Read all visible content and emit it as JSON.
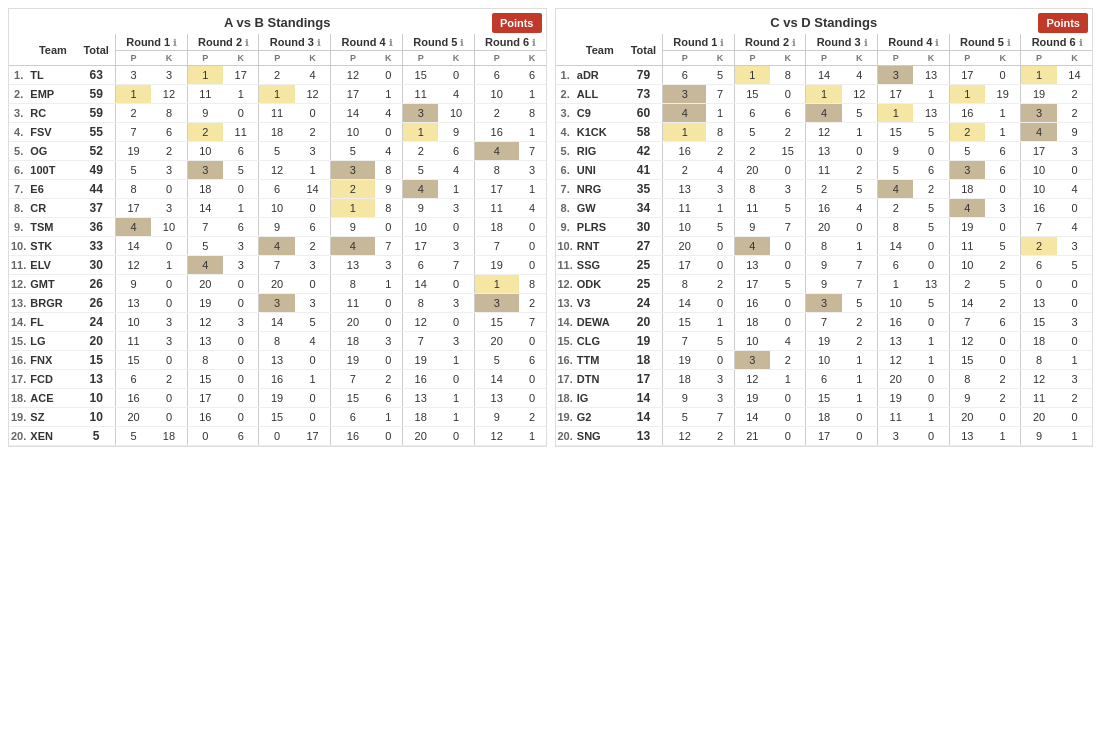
{
  "leftTable": {
    "title": "A vs B Standings",
    "pointsBtn": "Points",
    "columns": [
      "Team",
      "Total",
      "Round 1",
      "Round 2",
      "Round 3",
      "Round 4",
      "Round 5",
      "Round 6"
    ],
    "rows": [
      {
        "rank": "1.",
        "logo": "TL",
        "abbr": "TL",
        "total": "63",
        "r1p": "3",
        "r1k": "3",
        "r2p": "1",
        "r2k": "17",
        "r3p": "2",
        "r3k": "4",
        "r4p": "12",
        "r4k": "0",
        "r5p": "15",
        "r5k": "0",
        "r6p": "6",
        "r6k": "6",
        "highlights": {
          "r2p": "gold"
        }
      },
      {
        "rank": "2.",
        "logo": "EMP",
        "abbr": "EMP",
        "total": "59",
        "r1p": "1",
        "r1k": "12",
        "r2p": "11",
        "r2k": "1",
        "r3p": "1",
        "r3k": "12",
        "r4p": "17",
        "r4k": "1",
        "r5p": "11",
        "r5k": "4",
        "r6p": "10",
        "r6k": "1",
        "highlights": {
          "r1p": "gold",
          "r3p": "gold"
        }
      },
      {
        "rank": "3.",
        "logo": "RC",
        "abbr": "RC",
        "total": "59",
        "r1p": "2",
        "r1k": "8",
        "r2p": "9",
        "r2k": "0",
        "r3p": "11",
        "r3k": "0",
        "r4p": "14",
        "r4k": "4",
        "r5p": "3",
        "r5k": "10",
        "r6p": "2",
        "r6k": "8",
        "highlights": {
          "r5p": "tan"
        }
      },
      {
        "rank": "4.",
        "logo": "FSV",
        "abbr": "FSV",
        "total": "55",
        "r1p": "7",
        "r1k": "6",
        "r2p": "2",
        "r2k": "11",
        "r3p": "18",
        "r3k": "2",
        "r4p": "10",
        "r4k": "0",
        "r5p": "1",
        "r5k": "9",
        "r6p": "16",
        "r6k": "1",
        "highlights": {
          "r2p": "gold",
          "r5p": "gold"
        }
      },
      {
        "rank": "5.",
        "logo": "OG",
        "abbr": "OG",
        "total": "52",
        "r1p": "19",
        "r1k": "2",
        "r2p": "10",
        "r2k": "6",
        "r3p": "5",
        "r3k": "3",
        "r4p": "5",
        "r4k": "4",
        "r5p": "2",
        "r5k": "6",
        "r6p": "4",
        "r6k": "7",
        "highlights": {
          "r6p": "tan"
        }
      },
      {
        "rank": "6.",
        "logo": "100T",
        "abbr": "100T",
        "total": "49",
        "r1p": "5",
        "r1k": "3",
        "r2p": "3",
        "r2k": "5",
        "r3p": "12",
        "r3k": "1",
        "r4p": "3",
        "r4k": "8",
        "r5p": "5",
        "r5k": "4",
        "r6p": "8",
        "r6k": "3",
        "highlights": {
          "r2p": "tan",
          "r4p": "tan"
        }
      },
      {
        "rank": "7.",
        "logo": "E6",
        "abbr": "E6",
        "total": "44",
        "r1p": "8",
        "r1k": "0",
        "r2p": "18",
        "r2k": "0",
        "r3p": "6",
        "r3k": "14",
        "r4p": "2",
        "r4k": "9",
        "r5p": "4",
        "r5k": "1",
        "r6p": "17",
        "r6k": "1",
        "highlights": {
          "r4p": "gold",
          "r5p": "tan"
        }
      },
      {
        "rank": "8.",
        "logo": "CR",
        "abbr": "CR",
        "total": "37",
        "r1p": "17",
        "r1k": "3",
        "r2p": "14",
        "r2k": "1",
        "r3p": "10",
        "r3k": "0",
        "r4p": "1",
        "r4k": "8",
        "r5p": "9",
        "r5k": "3",
        "r6p": "11",
        "r6k": "4",
        "highlights": {
          "r4p": "gold"
        }
      },
      {
        "rank": "9.",
        "logo": "TSM",
        "abbr": "TSM",
        "total": "36",
        "r1p": "4",
        "r1k": "10",
        "r2p": "7",
        "r2k": "6",
        "r3p": "9",
        "r3k": "6",
        "r4p": "9",
        "r4k": "0",
        "r5p": "10",
        "r5k": "0",
        "r6p": "18",
        "r6k": "0",
        "highlights": {
          "r1p": "tan"
        }
      },
      {
        "rank": "10.",
        "logo": "STK",
        "abbr": "STK",
        "total": "33",
        "r1p": "14",
        "r1k": "0",
        "r2p": "5",
        "r2k": "3",
        "r3p": "4",
        "r3k": "2",
        "r4p": "4",
        "r4k": "7",
        "r5p": "17",
        "r5k": "3",
        "r6p": "7",
        "r6k": "0",
        "highlights": {
          "r3p": "tan",
          "r4p": "tan"
        }
      },
      {
        "rank": "11.",
        "logo": "ELV",
        "abbr": "ELV",
        "total": "30",
        "r1p": "12",
        "r1k": "1",
        "r2p": "4",
        "r2k": "3",
        "r3p": "7",
        "r3k": "3",
        "r4p": "13",
        "r4k": "3",
        "r5p": "6",
        "r5k": "7",
        "r6p": "19",
        "r6k": "0",
        "highlights": {
          "r2p": "tan"
        }
      },
      {
        "rank": "12.",
        "logo": "GMT",
        "abbr": "GMT",
        "total": "26",
        "r1p": "9",
        "r1k": "0",
        "r2p": "20",
        "r2k": "0",
        "r3p": "20",
        "r3k": "0",
        "r4p": "8",
        "r4k": "1",
        "r5p": "14",
        "r5k": "0",
        "r6p": "1",
        "r6k": "8",
        "highlights": {
          "r6p": "gold"
        }
      },
      {
        "rank": "13.",
        "logo": "BRGR",
        "abbr": "BRGR",
        "total": "26",
        "r1p": "13",
        "r1k": "0",
        "r2p": "19",
        "r2k": "0",
        "r3p": "3",
        "r3k": "3",
        "r4p": "11",
        "r4k": "0",
        "r5p": "8",
        "r5k": "3",
        "r6p": "3",
        "r6k": "2",
        "highlights": {
          "r3p": "tan",
          "r6p": "tan"
        }
      },
      {
        "rank": "14.",
        "logo": "FL",
        "abbr": "FL",
        "total": "24",
        "r1p": "10",
        "r1k": "3",
        "r2p": "12",
        "r2k": "3",
        "r3p": "14",
        "r3k": "5",
        "r4p": "20",
        "r4k": "0",
        "r5p": "12",
        "r5k": "0",
        "r6p": "15",
        "r6k": "7",
        "highlights": {}
      },
      {
        "rank": "15.",
        "logo": "LG",
        "abbr": "LG",
        "total": "20",
        "r1p": "11",
        "r1k": "3",
        "r2p": "13",
        "r2k": "0",
        "r3p": "8",
        "r3k": "4",
        "r4p": "18",
        "r4k": "3",
        "r5p": "7",
        "r5k": "3",
        "r6p": "20",
        "r6k": "0",
        "highlights": {}
      },
      {
        "rank": "16.",
        "logo": "FNX",
        "abbr": "FNX",
        "total": "15",
        "r1p": "15",
        "r1k": "0",
        "r2p": "8",
        "r2k": "0",
        "r3p": "13",
        "r3k": "0",
        "r4p": "19",
        "r4k": "0",
        "r5p": "19",
        "r5k": "1",
        "r6p": "5",
        "r6k": "6",
        "highlights": {}
      },
      {
        "rank": "17.",
        "logo": "FCD",
        "abbr": "FCD",
        "total": "13",
        "r1p": "6",
        "r1k": "2",
        "r2p": "15",
        "r2k": "0",
        "r3p": "16",
        "r3k": "1",
        "r4p": "7",
        "r4k": "2",
        "r5p": "16",
        "r5k": "0",
        "r6p": "14",
        "r6k": "0",
        "highlights": {}
      },
      {
        "rank": "18.",
        "logo": "ACE",
        "abbr": "ACE",
        "total": "10",
        "r1p": "16",
        "r1k": "0",
        "r2p": "17",
        "r2k": "0",
        "r3p": "19",
        "r3k": "0",
        "r4p": "15",
        "r4k": "6",
        "r5p": "13",
        "r5k": "1",
        "r6p": "13",
        "r6k": "0",
        "highlights": {}
      },
      {
        "rank": "19.",
        "logo": "SZ",
        "abbr": "SZ",
        "total": "10",
        "r1p": "20",
        "r1k": "0",
        "r2p": "16",
        "r2k": "0",
        "r3p": "15",
        "r3k": "0",
        "r4p": "6",
        "r4k": "1",
        "r5p": "18",
        "r5k": "1",
        "r6p": "9",
        "r6k": "2",
        "highlights": {}
      },
      {
        "rank": "20.",
        "logo": "XEN",
        "abbr": "XEN",
        "total": "5",
        "r1p": "5",
        "r1k": "18",
        "r2p": "0",
        "r2k": "6",
        "r3p": "0",
        "r3k": "17",
        "r4p": "16",
        "r4k": "0",
        "r5p": "20",
        "r5k": "0",
        "r6p": "12",
        "r6k": "1",
        "highlights": {}
      }
    ]
  },
  "rightTable": {
    "title": "C vs D Standings",
    "pointsBtn": "Points",
    "columns": [
      "Team",
      "Total",
      "Round 1",
      "Round 2",
      "Round 3",
      "Round 4",
      "Round 5",
      "Round 6"
    ],
    "rows": [
      {
        "rank": "1.",
        "abbr": "aDR",
        "total": "79",
        "r1p": "6",
        "r1k": "5",
        "r2p": "1",
        "r2k": "8",
        "r3p": "14",
        "r3k": "4",
        "r4p": "3",
        "r4k": "13",
        "r5p": "17",
        "r5k": "0",
        "r6p": "1",
        "r6k": "14",
        "highlights": {
          "r2p": "gold",
          "r4p": "tan",
          "r6p": "gold"
        }
      },
      {
        "rank": "2.",
        "abbr": "ALL",
        "total": "73",
        "r1p": "3",
        "r1k": "7",
        "r2p": "15",
        "r2k": "0",
        "r3p": "1",
        "r3k": "12",
        "r4p": "17",
        "r4k": "1",
        "r5p": "1",
        "r5k": "19",
        "r6p": "19",
        "r6k": "2",
        "highlights": {
          "r1p": "tan",
          "r3p": "gold",
          "r5p": "gold"
        }
      },
      {
        "rank": "3.",
        "abbr": "C9",
        "total": "60",
        "r1p": "4",
        "r1k": "1",
        "r2p": "6",
        "r2k": "6",
        "r3p": "4",
        "r3k": "5",
        "r4p": "1",
        "r4k": "13",
        "r5p": "16",
        "r5k": "1",
        "r6p": "3",
        "r6k": "2",
        "highlights": {
          "r1p": "tan",
          "r3p": "tan",
          "r4p": "gold",
          "r6p": "tan"
        }
      },
      {
        "rank": "4.",
        "abbr": "K1CK",
        "total": "58",
        "r1p": "1",
        "r1k": "8",
        "r2p": "5",
        "r2k": "2",
        "r3p": "12",
        "r3k": "1",
        "r4p": "15",
        "r4k": "5",
        "r5p": "2",
        "r5k": "1",
        "r6p": "4",
        "r6k": "9",
        "highlights": {
          "r1p": "gold",
          "r5p": "gold",
          "r6p": "tan"
        }
      },
      {
        "rank": "5.",
        "abbr": "RIG",
        "total": "42",
        "r1p": "16",
        "r1k": "2",
        "r2p": "2",
        "r2k": "15",
        "r3p": "13",
        "r3k": "0",
        "r4p": "9",
        "r4k": "0",
        "r5p": "5",
        "r5k": "6",
        "r6p": "17",
        "r6k": "3",
        "highlights": {}
      },
      {
        "rank": "6.",
        "abbr": "UNI",
        "total": "41",
        "r1p": "2",
        "r1k": "4",
        "r2p": "20",
        "r2k": "0",
        "r3p": "11",
        "r3k": "2",
        "r4p": "5",
        "r4k": "6",
        "r5p": "3",
        "r5k": "6",
        "r6p": "10",
        "r6k": "0",
        "highlights": {
          "r5p": "tan"
        }
      },
      {
        "rank": "7.",
        "abbr": "NRG",
        "total": "35",
        "r1p": "13",
        "r1k": "3",
        "r2p": "8",
        "r2k": "3",
        "r3p": "2",
        "r3k": "5",
        "r4p": "4",
        "r4k": "2",
        "r5p": "18",
        "r5k": "0",
        "r6p": "10",
        "r6k": "4",
        "highlights": {
          "r4p": "tan"
        }
      },
      {
        "rank": "8.",
        "abbr": "GW",
        "total": "34",
        "r1p": "11",
        "r1k": "1",
        "r2p": "11",
        "r2k": "5",
        "r3p": "16",
        "r3k": "4",
        "r4p": "2",
        "r4k": "5",
        "r5p": "4",
        "r5k": "3",
        "r6p": "16",
        "r6k": "0",
        "highlights": {
          "r5p": "tan"
        }
      },
      {
        "rank": "9.",
        "abbr": "PLRS",
        "total": "30",
        "r1p": "10",
        "r1k": "5",
        "r2p": "9",
        "r2k": "7",
        "r3p": "20",
        "r3k": "0",
        "r4p": "8",
        "r4k": "5",
        "r5p": "19",
        "r5k": "0",
        "r6p": "7",
        "r6k": "4",
        "highlights": {}
      },
      {
        "rank": "10.",
        "abbr": "RNT",
        "total": "27",
        "r1p": "20",
        "r1k": "0",
        "r2p": "4",
        "r2k": "0",
        "r3p": "8",
        "r3k": "1",
        "r4p": "14",
        "r4k": "0",
        "r5p": "11",
        "r5k": "5",
        "r6p": "2",
        "r6k": "3",
        "highlights": {
          "r2p": "tan",
          "r6p": "gold"
        }
      },
      {
        "rank": "11.",
        "abbr": "SSG",
        "total": "25",
        "r1p": "17",
        "r1k": "0",
        "r2p": "13",
        "r2k": "0",
        "r3p": "9",
        "r3k": "7",
        "r4p": "6",
        "r4k": "0",
        "r5p": "10",
        "r5k": "2",
        "r6p": "6",
        "r6k": "5",
        "highlights": {}
      },
      {
        "rank": "12.",
        "abbr": "ODK",
        "total": "25",
        "r1p": "8",
        "r1k": "2",
        "r2p": "17",
        "r2k": "5",
        "r3p": "9",
        "r3k": "7",
        "r4p": "1",
        "r4k": "13",
        "r5p": "2",
        "r5k": "5",
        "r6p": "0",
        "r6k": "0",
        "highlights": {}
      },
      {
        "rank": "13.",
        "abbr": "V3",
        "total": "24",
        "r1p": "14",
        "r1k": "0",
        "r2p": "16",
        "r2k": "0",
        "r3p": "3",
        "r3k": "5",
        "r4p": "10",
        "r4k": "5",
        "r5p": "14",
        "r5k": "2",
        "r6p": "13",
        "r6k": "0",
        "highlights": {
          "r3p": "tan"
        }
      },
      {
        "rank": "14.",
        "abbr": "DEWA",
        "total": "20",
        "r1p": "15",
        "r1k": "1",
        "r2p": "18",
        "r2k": "0",
        "r3p": "7",
        "r3k": "2",
        "r4p": "16",
        "r4k": "0",
        "r5p": "7",
        "r5k": "6",
        "r6p": "15",
        "r6k": "3",
        "highlights": {}
      },
      {
        "rank": "15.",
        "abbr": "CLG",
        "total": "19",
        "r1p": "7",
        "r1k": "5",
        "r2p": "10",
        "r2k": "4",
        "r3p": "19",
        "r3k": "2",
        "r4p": "13",
        "r4k": "1",
        "r5p": "12",
        "r5k": "0",
        "r6p": "18",
        "r6k": "0",
        "highlights": {}
      },
      {
        "rank": "16.",
        "abbr": "TTM",
        "total": "18",
        "r1p": "19",
        "r1k": "0",
        "r2p": "3",
        "r2k": "2",
        "r3p": "10",
        "r3k": "1",
        "r4p": "12",
        "r4k": "1",
        "r5p": "15",
        "r5k": "0",
        "r6p": "8",
        "r6k": "1",
        "highlights": {
          "r2p": "tan"
        }
      },
      {
        "rank": "17.",
        "abbr": "DTN",
        "total": "17",
        "r1p": "18",
        "r1k": "3",
        "r2p": "12",
        "r2k": "1",
        "r3p": "6",
        "r3k": "1",
        "r4p": "20",
        "r4k": "0",
        "r5p": "8",
        "r5k": "2",
        "r6p": "12",
        "r6k": "3",
        "highlights": {}
      },
      {
        "rank": "18.",
        "abbr": "IG",
        "total": "14",
        "r1p": "9",
        "r1k": "3",
        "r2p": "19",
        "r2k": "0",
        "r3p": "15",
        "r3k": "1",
        "r4p": "19",
        "r4k": "0",
        "r5p": "9",
        "r5k": "2",
        "r6p": "11",
        "r6k": "2",
        "highlights": {}
      },
      {
        "rank": "19.",
        "abbr": "G2",
        "total": "14",
        "r1p": "5",
        "r1k": "7",
        "r2p": "14",
        "r2k": "0",
        "r3p": "18",
        "r3k": "0",
        "r4p": "11",
        "r4k": "1",
        "r5p": "20",
        "r5k": "0",
        "r6p": "20",
        "r6k": "0",
        "highlights": {}
      },
      {
        "rank": "20.",
        "abbr": "SNG",
        "total": "13",
        "r1p": "12",
        "r1k": "2",
        "r2p": "21",
        "r2k": "0",
        "r3p": "17",
        "r3k": "0",
        "r4p": "3",
        "r4k": "0",
        "r5p": "13",
        "r5k": "1",
        "r6p": "9",
        "r6k": "1",
        "highlights": {}
      }
    ]
  }
}
